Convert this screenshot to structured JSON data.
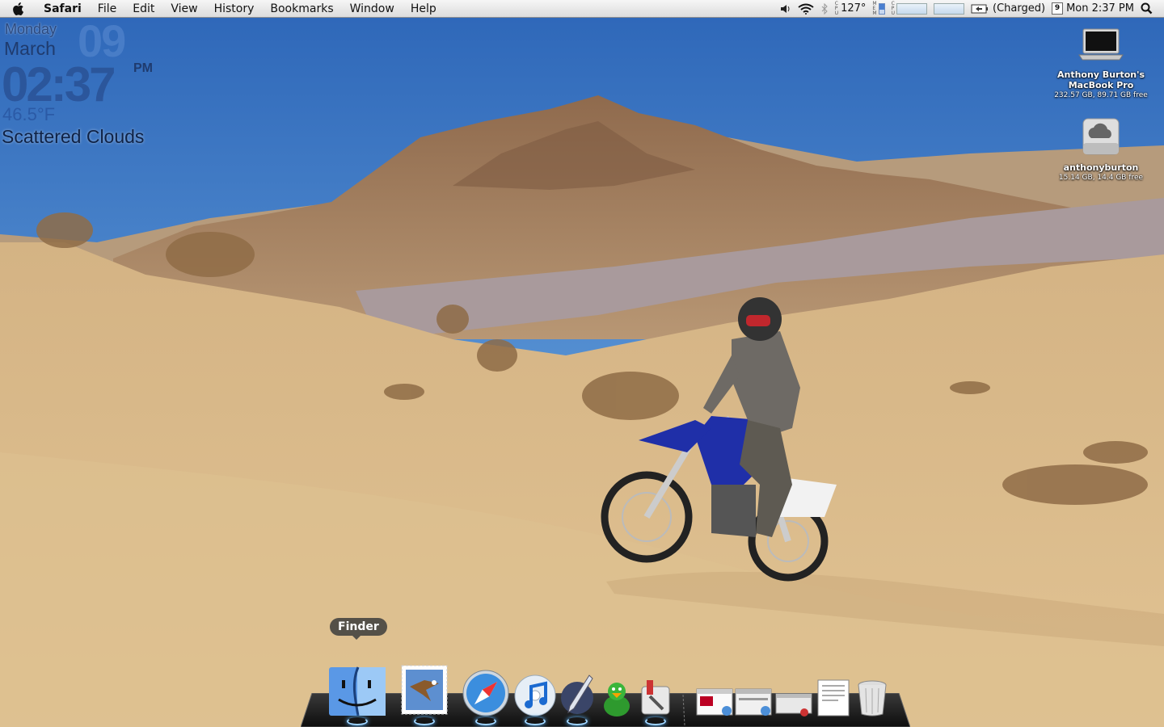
{
  "menubar": {
    "app_name": "Safari",
    "menus": [
      "File",
      "Edit",
      "View",
      "History",
      "Bookmarks",
      "Window",
      "Help"
    ],
    "temperature": "127°",
    "battery_status": "(Charged)",
    "calendar_day": "9",
    "clock": "Mon 2:37 PM",
    "status_icons": [
      "volume-icon",
      "wifi-icon",
      "bluetooth-icon",
      "cpu-temp-icon",
      "memory-meter-icon",
      "cpu-graph-icon",
      "network-graph-icon",
      "battery-icon",
      "calendar-icon",
      "spotlight-icon"
    ]
  },
  "widget": {
    "day": "Monday",
    "month": "March",
    "date": "09",
    "time": "02:37",
    "ampm": "PM",
    "temperature": "46.5°F",
    "conditions": "Scattered Clouds"
  },
  "desktop_icons": [
    {
      "name_line1": "Anthony Burton's",
      "name_line2": "MacBook Pro",
      "info": "232.57 GB, 89.71 GB free",
      "icon": "laptop-icon"
    },
    {
      "name_line1": "anthonyburton",
      "name_line2": "",
      "info": "15.14 GB, 14.4 GB free",
      "icon": "cloud-drive-icon"
    }
  ],
  "dock": {
    "tooltip": "Finder",
    "apps": [
      "Finder",
      "Mail",
      "Safari",
      "iTunes",
      "Pen app",
      "Adium",
      "Utility"
    ],
    "running": [
      true,
      true,
      true,
      true,
      true,
      false,
      true
    ],
    "stacks": [
      "Window 1",
      "Window 2",
      "Window 3",
      "Document",
      "Trash"
    ]
  },
  "colors": {
    "sky_top": "#3a76c6",
    "sand": "#d9b683",
    "bike_blue": "#1f2fa8"
  }
}
